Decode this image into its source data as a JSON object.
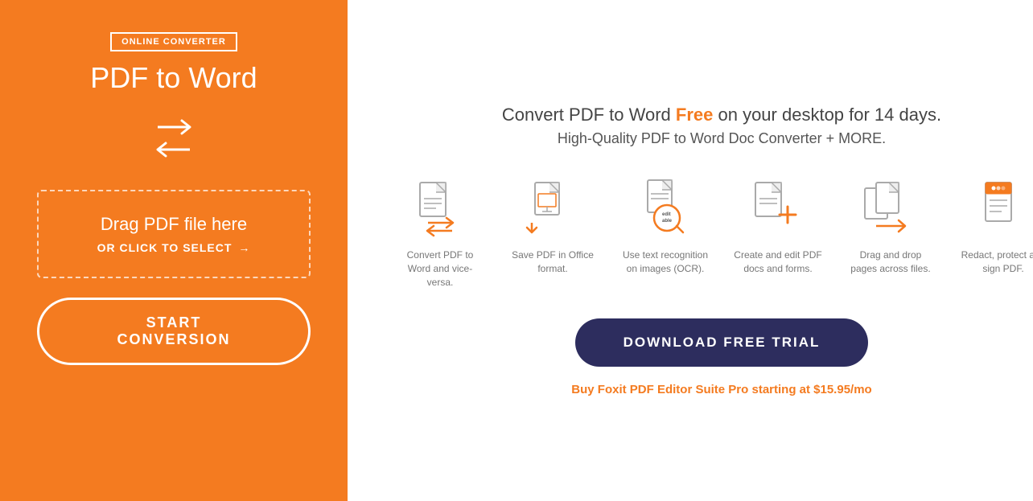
{
  "left": {
    "badge": "ONLINE CONVERTER",
    "title": "PDF to Word",
    "dropzone_main": "Drag PDF file here",
    "dropzone_sub": "OR CLICK TO SELECT",
    "dropzone_arrow": "→",
    "start_btn": "START CONVERSION"
  },
  "right": {
    "headline_part1": "Convert PDF to Word ",
    "headline_free": "Free",
    "headline_part2": " on your desktop for 14 days.",
    "subheadline": "High-Quality PDF to Word Doc Converter + MORE.",
    "features": [
      {
        "label": "Convert PDF to Word and vice-versa.",
        "icon": "convert"
      },
      {
        "label": "Save PDF in Office format.",
        "icon": "office"
      },
      {
        "label": "Use text recognition on images (OCR).",
        "icon": "ocr"
      },
      {
        "label": "Create and edit PDF docs and forms.",
        "icon": "edit"
      },
      {
        "label": "Drag and drop pages across files.",
        "icon": "drag"
      },
      {
        "label": "Redact, protect and sign PDF.",
        "icon": "redact"
      }
    ],
    "download_btn": "DOWNLOAD FREE TRIAL",
    "buy_link": "Buy Foxit PDF Editor Suite Pro starting at $15.95/mo"
  },
  "colors": {
    "orange": "#F47B20",
    "dark_blue": "#2D2D5E"
  }
}
